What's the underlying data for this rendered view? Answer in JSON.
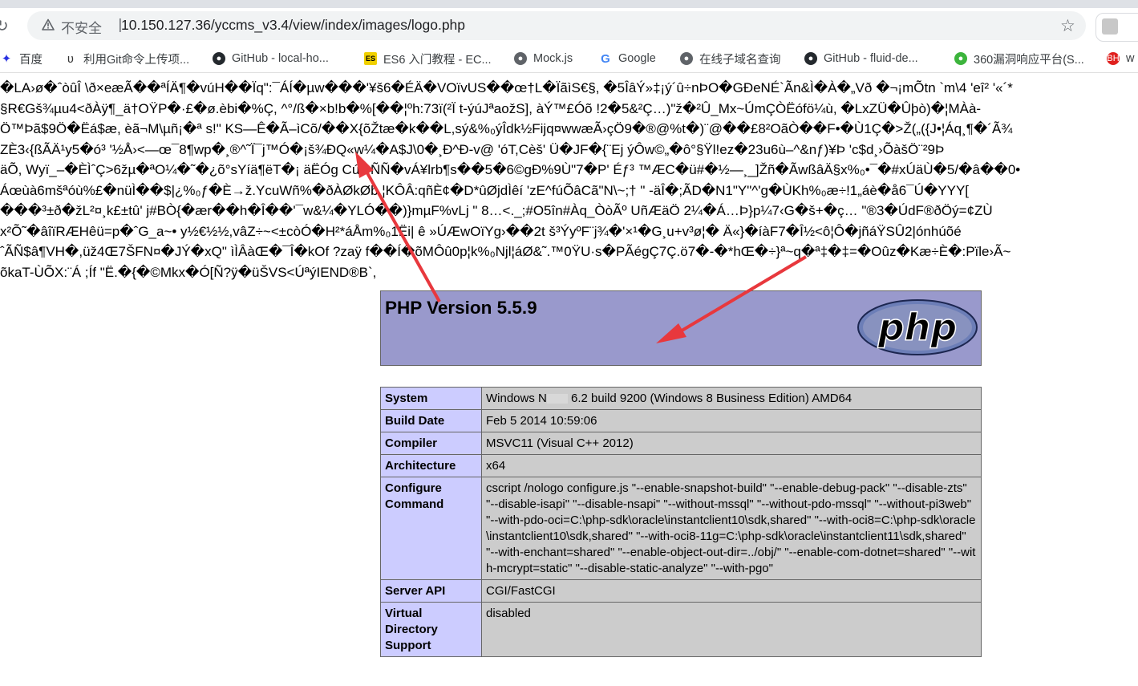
{
  "browser": {
    "insecure_label": "不安全",
    "separator": "|",
    "url": "10.150.127.36/yccms_v3.4/view/index/images/logo.php",
    "star_icon": "star-icon"
  },
  "bookmarks": [
    {
      "label": "百度",
      "icon": "baidu-paw-icon",
      "color": "#2932e1"
    },
    {
      "label": "利用Git命令上传项...",
      "icon": "git-user-icon",
      "color": "#333333"
    },
    {
      "label": "GitHub - local-ho...",
      "icon": "github-icon",
      "color": "#24292e"
    },
    {
      "label": "ES6 入门教程 - EC...",
      "icon": "es-icon",
      "color": "#f0d000"
    },
    {
      "label": "Mock.js",
      "icon": "globe-icon",
      "color": "#5f6368"
    },
    {
      "label": "Google",
      "icon": "google-icon",
      "color": "#4285f4"
    },
    {
      "label": "在线子域名查询",
      "icon": "globe-icon",
      "color": "#5f6368"
    },
    {
      "label": "GitHub - fluid-de...",
      "icon": "github-icon",
      "color": "#24292e"
    },
    {
      "label": "360漏洞响应平台(S...",
      "icon": "360-icon",
      "color": "#3cb43c"
    },
    {
      "label": "w",
      "icon": "bh-icon",
      "color": "#e0201e"
    }
  ],
  "garbage_lines": [
    "�LA›ø�ˆòûÎ \\ð×eæÃ��ªÍÄ¶�vúH��Ïq\":¯ÁÍ�µw���'¥š6�ÉÄ�VOïvUS��œ†L�ÏãìS€§,  �5ÎâÝ»‡¡ý´û÷nÞO�GÐeNÉ`Ãn&Ì�À�„Vð �¬¡mÕtn `m\\4   'eî²   '«´*",
    "§R€Gš¾µu4<ðÀÿ¶_ä†OŸP�·£�ø.èbi�%Ç,    ^°/ß�×b!b�%[��¦ºh:73ï(²Ï t-ýúJªaožS], àÝ™£Óõ !2�5&²Ç…)\"ž�²Û_Mx~ÚmÇÒËófö¼ù, �LxZÜ�Ûþò)�¦MÀà-",
    "Ö™Þã$9Ö�Ëá$æ, èã¬M\\µñ¡�ª s!\"  KS—Ê�Ã–ìCõ/��X{õŽtæ�k��L,sý&%₀ýÎdk½Fijq¤wwæÃ›çÖ9�®@%t�)¨@��£8²OãÒ��F•�Ù1Ç�>Ž(„({J•¦Áq¸¶�´Ã¾",
    "ZÈ3‹{ßÃÄ¹y5�ó³   '½Å›<—œ¯8¶wp�¸®^˜Ï¯j™Ó�¡š¾ÐQ«w¼�A$J\\0�¸Ð^Ð-v@   'óT,Cèš'   Ü�JF�{¨Ej ýÔw©„�ô°§Ÿl!ez�23u6ù–^&nƒ)¥Þ   'c$d¸›ÕàšÖ¨²9Þ",
    "äÕ, Wyï_–�ÈÌˆÇ>6žµ�ªO¼�˜�¿õ°sYíä¶ëT�¡ äËÓg Cúj×ÑÑ�vÁ¥lrb¶s��5�6©gÐ%9Ù\"7�P' Éƒ³ ™ÆC�ü#�½—¸_]Žñ�ÃwßâÄ§x%₀•¯�#xÚäÙ�5/�â��0•",
    "Áœùà6mšªóù%£�nüÌ��$|¿%₀ƒ�È→ž.YcuWñ%�ðÀØkØb.¦KÔÂ:qñÈ¢�D*ûØjdÌêí   'zE^fúÕâCã\"N\\~;† \"   -äÎ�;ÃD�N1\"Y\"^'g�ÙKh%₀æ÷!1„áè�å6¯Ú�YYY[",
    "���³±ð�žL²¤¸k£±tû'   j#BÒ{�ær��h�Î��'¯w&¼�YLÓ��)}mµF%vLj \"   8…<._;#O5în#Àq_ÒòÃº UñÆäÖ 2¼�Á…Þ}p¼7‹G�š+�ç…   \"®3�ÚdF®ðÖý=¢ZÙ",
    "x²Õ˜�âîïRÆHêü=p�ˆG_a~• y½€½½,vâZ÷~<±còÓ�H²*áÅm%₀1Ëi| ê »ÚÆwOïYg›��2t š³ÝyºF¨j¾�'×¹�G¸u+v³ø¦� Ä«}�íàF7�Î½<ô¦Ô�jñáŸSÛ2|ónhúõé",
    "ˆÃÑ$â¶VH�,üž4Œ7ŠFN¤�JÝ�xQ\"  ìÌÂàŒ�¯Î�kOf ?zaÿ f��Í�õMÔû0p¦k%₀Njl¦áØ&˜.™0ŸU·s�PÃégÇ7Ç.ö7�-�*hŒ�÷}ª~q�ª‡�‡=�Oûz�Kæ÷È�:Pïle›Ã~",
    "õkaT-ÙÕX:¨Á ;Íf \"Ë.�{�©Mkx�Ó[Ñ?ÿ�üŠVS<ÚªýIEND®B`,"
  ],
  "php_header": {
    "version_title": "PHP Version 5.5.9",
    "logo_text": "php"
  },
  "info_rows": [
    {
      "key": "System",
      "value_prefix": "Windows N",
      "value_suffix": " 6.2 build 9200 (Windows 8 Business Edition) AMD64"
    },
    {
      "key": "Build Date",
      "value": "Feb 5 2014 10:59:06"
    },
    {
      "key": "Compiler",
      "value": "MSVC11 (Visual C++ 2012)"
    },
    {
      "key": "Architecture",
      "value": "x64"
    },
    {
      "key": "Configure Command",
      "value": "cscript /nologo configure.js \"--enable-snapshot-build\" \"--enable-debug-pack\" \"--disable-zts\" \"--disable-isapi\" \"--disable-nsapi\" \"--without-mssql\" \"--without-pdo-mssql\" \"--without-pi3web\" \"--with-pdo-oci=C:\\php-sdk\\oracle\\instantclient10\\sdk,shared\" \"--with-oci8=C:\\php-sdk\\oracle\\instantclient10\\sdk,shared\" \"--with-oci8-11g=C:\\php-sdk\\oracle\\instantclient11\\sdk,shared\" \"--with-enchant=shared\" \"--enable-object-out-dir=../obj/\" \"--enable-com-dotnet=shared\" \"--with-mcrypt=static\" \"--disable-static-analyze\" \"--with-pgo\""
    },
    {
      "key": "Server API",
      "value": "CGI/FastCGI"
    },
    {
      "key": "Virtual Directory Support",
      "value": "disabled"
    }
  ],
  "annotation_color": "#e8383d"
}
